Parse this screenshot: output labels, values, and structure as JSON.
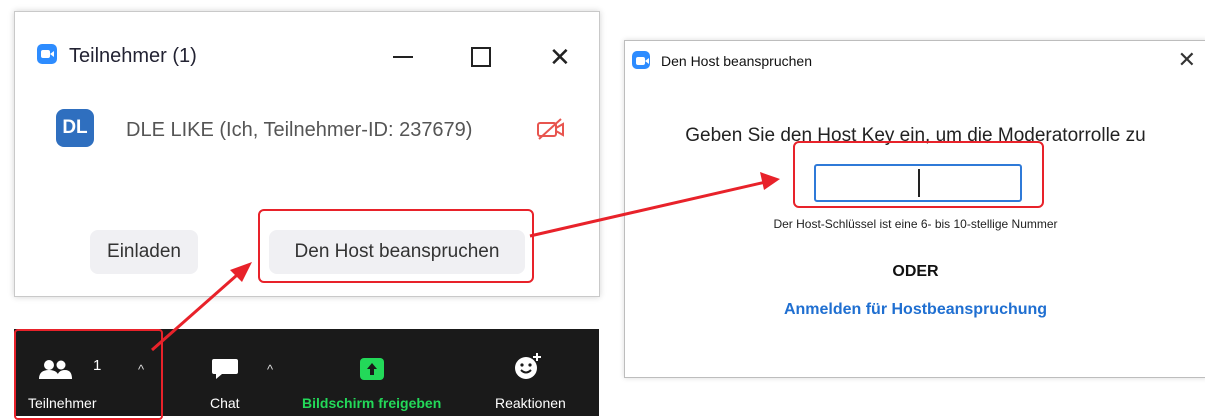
{
  "participants_window": {
    "title": "Teilnehmer (1)",
    "participant": {
      "initials": "DL",
      "name": "DLE LIKE (Ich, Teilnehmer-ID: 237679)"
    },
    "invite_button": "Einladen",
    "claim_host_button": "Den Host beanspruchen"
  },
  "toolbar": {
    "participants": {
      "label": "Teilnehmer",
      "count": "1"
    },
    "chat": {
      "label": "Chat"
    },
    "share": {
      "label": "Bildschirm freigeben"
    },
    "reactions": {
      "label": "Reaktionen"
    }
  },
  "dialog": {
    "title": "Den Host beanspruchen",
    "prompt": "Geben Sie den Host Key ein, um die Moderatorrolle zu",
    "host_key_value": "",
    "hint": "Der Host-Schlüssel ist eine 6- bis 10-stellige Nummer",
    "or_label": "ODER",
    "sign_in_link": "Anmelden für Hostbeanspruchung"
  },
  "colors": {
    "zoom_blue": "#2d8cff",
    "annotation_red": "#e8222a",
    "share_green": "#23d959",
    "link_blue": "#1f6fd1",
    "toolbar_bg": "#1a1a1a"
  }
}
